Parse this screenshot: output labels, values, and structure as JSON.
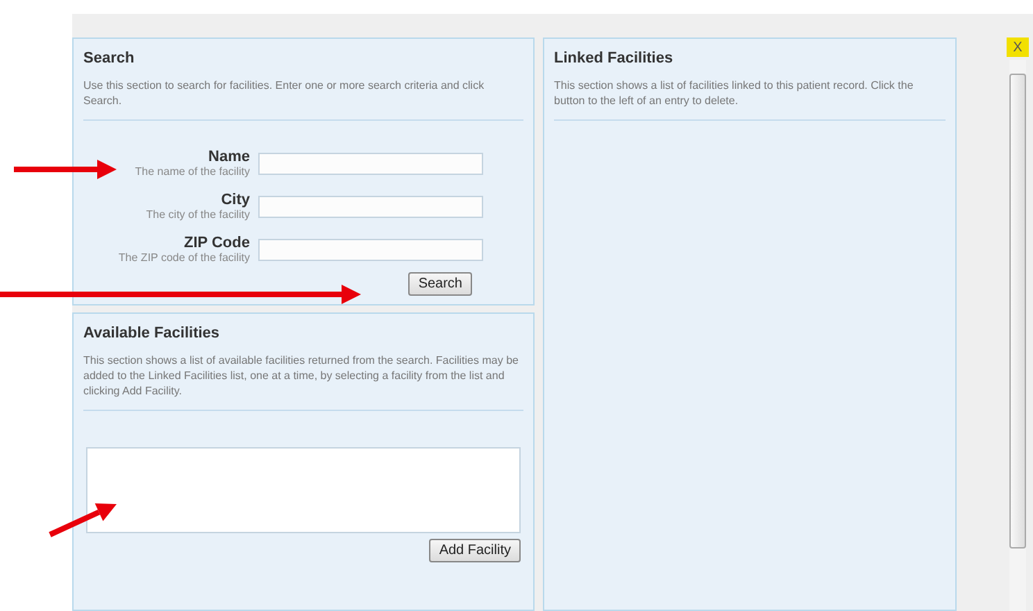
{
  "close_button": {
    "label": "X"
  },
  "search": {
    "title": "Search",
    "description": "Use this section to search for facilities. Enter one or more search criteria and click Search.",
    "fields": [
      {
        "label": "Name",
        "hint": "The name of the facility"
      },
      {
        "label": "City",
        "hint": "The city of the facility"
      },
      {
        "label": "ZIP Code",
        "hint": "The ZIP code of the facility"
      }
    ],
    "button": "Search"
  },
  "available": {
    "title": "Available Facilities",
    "description": "This section shows a list of available facilities returned from the search. Facilities may be added to the Linked Facilities list, one at a time, by selecting a facility from the list and clicking Add Facility.",
    "button": "Add Facility"
  },
  "linked": {
    "title": "Linked Facilities",
    "description": "This section shows a list of facilities linked to this patient record. Click the button to the left of an entry to delete."
  }
}
